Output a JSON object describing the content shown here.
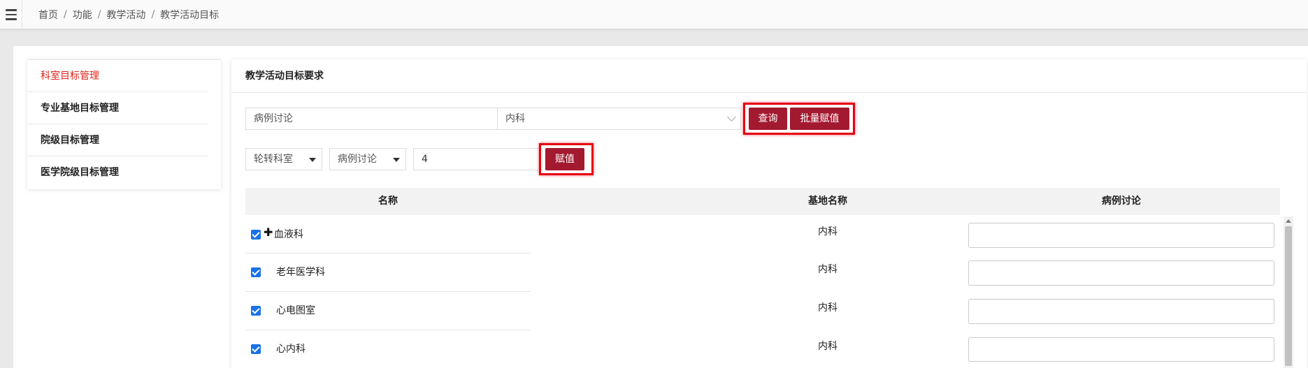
{
  "breadcrumb": [
    "首页",
    "功能",
    "教学活动",
    "教学活动目标"
  ],
  "breadcrumb_sep": "/",
  "sidebar": {
    "items": [
      {
        "label": "科室目标管理",
        "active": true
      },
      {
        "label": "专业基地目标管理",
        "active": false
      },
      {
        "label": "院级目标管理",
        "active": false
      },
      {
        "label": "医学院级目标管理",
        "active": false
      }
    ]
  },
  "panel": {
    "title": "教学活动目标要求",
    "filter": {
      "activity_select": "病例讨论",
      "dept_select": "内科",
      "query_button": "查询",
      "batch_assign_button": "批量赋值"
    },
    "assign": {
      "type_select": "轮转科室",
      "activity_select": "病例讨论",
      "value_input": "4",
      "assign_button": "赋值"
    },
    "table": {
      "headers": [
        "名称",
        "基地名称",
        "病例讨论"
      ],
      "rows": [
        {
          "name": "血液科",
          "base": "内科",
          "checked": true,
          "expandable": true,
          "value": ""
        },
        {
          "name": "老年医学科",
          "base": "内科",
          "checked": true,
          "expandable": false,
          "value": ""
        },
        {
          "name": "心电图室",
          "base": "内科",
          "checked": true,
          "expandable": false,
          "value": ""
        },
        {
          "name": "心内科",
          "base": "内科",
          "checked": true,
          "expandable": false,
          "value": ""
        }
      ]
    }
  },
  "colors": {
    "accent_button": "#a3192f",
    "highlight_border": "#e60012",
    "active_sidebar": "#e2231a",
    "checkbox": "#1a73e8"
  },
  "icons": {
    "menu": "hamburger-menu-icon",
    "dropdown": "chevron-down-icon",
    "expand": "plus-icon",
    "checkbox": "checkmark-icon"
  }
}
